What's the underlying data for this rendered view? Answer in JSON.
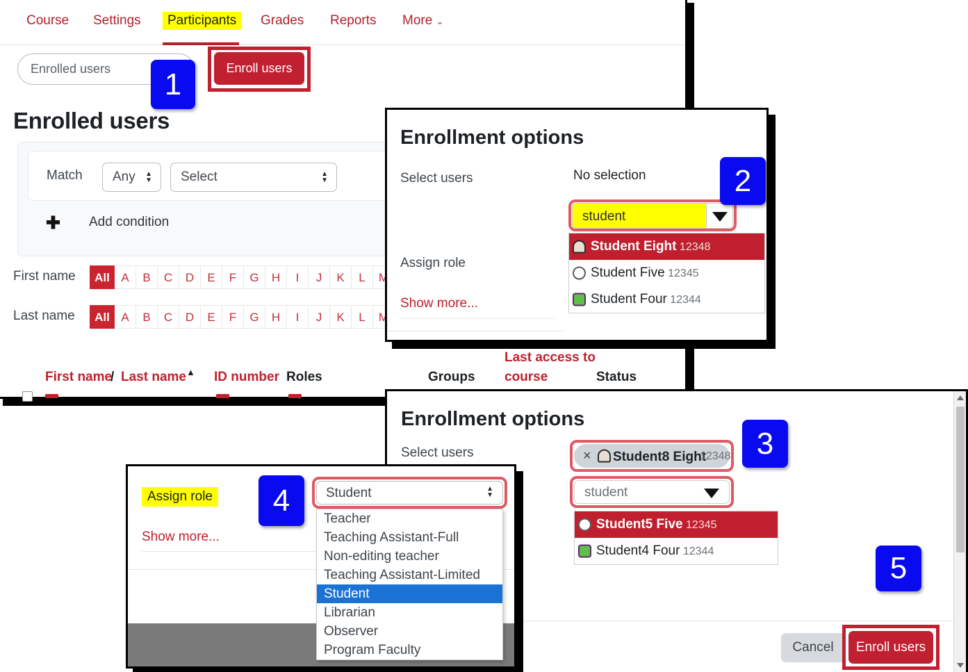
{
  "colors": {
    "brand_red": "#c02030",
    "badge_blue": "#0a0af0",
    "highlight_yellow": "#ffff00",
    "select_blue": "#1a73d4"
  },
  "participants_page": {
    "nav_tabs": [
      {
        "label": "Course",
        "active": false
      },
      {
        "label": "Settings",
        "active": false
      },
      {
        "label": "Participants",
        "active": true
      },
      {
        "label": "Grades",
        "active": false
      },
      {
        "label": "Reports",
        "active": false
      },
      {
        "label": "More",
        "active": false,
        "caret": "⌄"
      }
    ],
    "enrolled_select_value": "Enrolled users",
    "enroll_users_button": "Enroll users",
    "page_title": "Enrolled users",
    "filter": {
      "match_label": "Match",
      "match_value": "Any",
      "condition_value": "Select",
      "add_condition": "Add condition",
      "plus_icon": "✚"
    },
    "alpha_filters": {
      "first_name_label": "First name",
      "last_name_label": "Last name",
      "all_label": "All",
      "letters": [
        "A",
        "B",
        "C",
        "D",
        "E",
        "F",
        "G",
        "H",
        "I",
        "J",
        "K",
        "L",
        "M"
      ]
    },
    "table_headers": {
      "first_name": "First name",
      "separator": "/",
      "last_name": "Last name",
      "sort_arrow": "▲",
      "id_number": "ID number",
      "roles": "Roles",
      "groups": "Groups",
      "last_access_line1": "Last access to",
      "last_access_line2": "course",
      "status": "Status"
    }
  },
  "dialog_a": {
    "title": "Enrollment options",
    "select_users_label": "Select users",
    "no_selection": "No selection",
    "search_value": "student",
    "dropdown_caret": "▼",
    "assign_role_label": "Assign role",
    "show_more": "Show more...",
    "suggestions": [
      {
        "name": "Student Eight",
        "id": "12348",
        "avatar": "avatar-bell-icon",
        "selected": true
      },
      {
        "name": "Student Five",
        "id": "12345",
        "avatar": "avatar-circle-icon",
        "selected": false
      },
      {
        "name": "Student Four",
        "id": "12344",
        "avatar": "avatar-monster-icon",
        "selected": false
      }
    ]
  },
  "dialog_b": {
    "title": "Enrollment options",
    "select_users_label": "Select users",
    "selected_chip": {
      "remove_icon": "×",
      "avatar": "avatar-bell-icon",
      "name": "Student8 Eight",
      "id": "12348"
    },
    "search_value": "student",
    "dropdown_caret": "▼",
    "suggestions": [
      {
        "name": "Student5 Five",
        "id": "12345",
        "avatar": "avatar-circle-icon",
        "selected": true
      },
      {
        "name": "Student4 Four",
        "id": "12344",
        "avatar": "avatar-monster-icon",
        "selected": false
      }
    ],
    "cancel_button": "Cancel",
    "enroll_users_button": "Enroll users"
  },
  "dialog_role": {
    "assign_role_label": "Assign role",
    "show_more": "Show more...",
    "selected_role": "Student",
    "options": [
      "Teacher",
      "Teaching Assistant-Full",
      "Non-editing teacher",
      "Teaching Assistant-Limited",
      "Student",
      "Librarian",
      "Observer",
      "Program Faculty"
    ]
  },
  "step_badges": [
    {
      "number": "1"
    },
    {
      "number": "2"
    },
    {
      "number": "3"
    },
    {
      "number": "4"
    },
    {
      "number": "5"
    }
  ]
}
